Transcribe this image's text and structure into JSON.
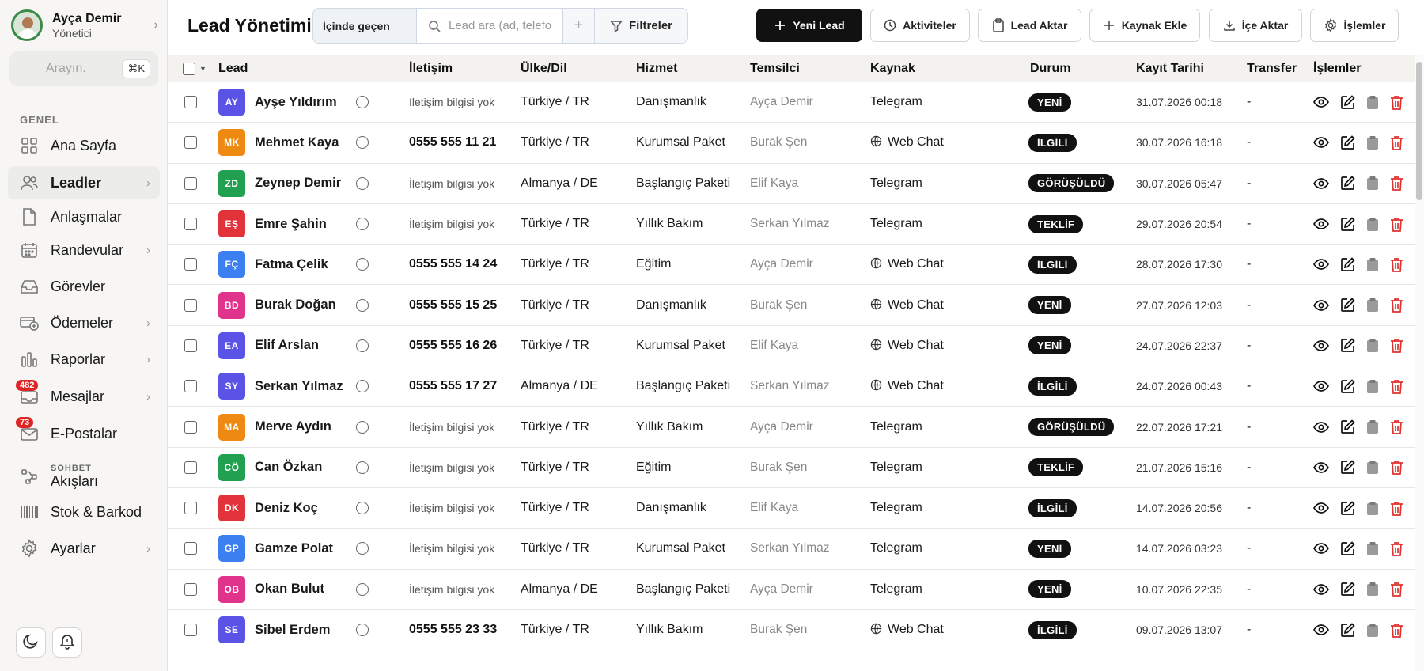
{
  "profile": {
    "name": "Ayça Demir",
    "role": "Yönetici"
  },
  "search": {
    "placeholder": "Arayın.",
    "shortcut": "⌘K"
  },
  "sidebar": {
    "section": "GENEL",
    "items": [
      {
        "label": "Ana Sayfa",
        "icon": "grid-icon"
      },
      {
        "label": "Leadler",
        "icon": "users-icon",
        "active": true
      },
      {
        "label": "Anlaşmalar",
        "icon": "document-icon"
      },
      {
        "label": "Randevular",
        "icon": "calendar-icon"
      },
      {
        "label": "Görevler",
        "icon": "inbox-icon"
      },
      {
        "label": "Ödemeler",
        "icon": "payments-icon"
      },
      {
        "label": "Raporlar",
        "icon": "bar-chart-icon"
      },
      {
        "label": "Mesajlar",
        "icon": "message-icon",
        "badge": "482"
      },
      {
        "label": "E-Postalar",
        "icon": "mail-icon",
        "badge": "73"
      },
      {
        "small": "SOHBET",
        "label": "Akışları",
        "icon": "flow-icon"
      },
      {
        "label": "Stok & Barkod",
        "icon": "barcode-icon"
      },
      {
        "label": "Ayarlar",
        "icon": "gear-icon"
      }
    ]
  },
  "header": {
    "title": "Lead Yönetimi",
    "filter_mode": "İçinde geçen",
    "search_placeholder": "Lead ara (ad, telefon, e-posta)",
    "filters_label": "Filtreler",
    "buttons": {
      "new_lead": "Yeni Lead",
      "activities": "Aktiviteler",
      "transfer": "Lead Aktar",
      "add_source": "Kaynak Ekle",
      "import": "İçe Aktar",
      "operations": "İşlemler"
    }
  },
  "table": {
    "columns": [
      "Lead",
      "İletişim",
      "Ülke/Dil",
      "Hizmet",
      "Temsilci",
      "Kaynak",
      "Durum",
      "Kayıt Tarihi",
      "Transfer",
      "İşlemler"
    ],
    "rows": [
      {
        "initials": "AY",
        "color": "#5b52e6",
        "name": "Ayşe Yıldırım",
        "contact": "İletişim bilgisi yok",
        "country": "Türkiye / TR",
        "service": "Danışmanlık",
        "rep": "Ayça Demir",
        "source": "Telegram",
        "status": "YENİ",
        "date": "31.07.2026 00:18",
        "transfer": "-"
      },
      {
        "initials": "MK",
        "color": "#ee8a12",
        "name": "Mehmet Kaya",
        "contact": "0555 555 11 21",
        "country": "Türkiye / TR",
        "service": "Kurumsal Paket",
        "rep": "Burak Şen",
        "source": "Web Chat",
        "status": "İLGİLİ",
        "date": "30.07.2026 16:18",
        "transfer": "-"
      },
      {
        "initials": "ZD",
        "color": "#22a052",
        "name": "Zeynep Demir",
        "contact": "İletişim bilgisi yok",
        "country": "Almanya / DE",
        "service": "Başlangıç Paketi",
        "rep": "Elif Kaya",
        "source": "Telegram",
        "status": "GÖRÜŞÜLDÜ",
        "date": "30.07.2026 05:47",
        "transfer": "-"
      },
      {
        "initials": "EŞ",
        "color": "#e2323a",
        "name": "Emre Şahin",
        "contact": "İletişim bilgisi yok",
        "country": "Türkiye / TR",
        "service": "Yıllık Bakım",
        "rep": "Serkan Yılmaz",
        "source": "Telegram",
        "status": "TEKLİF",
        "date": "29.07.2026 20:54",
        "transfer": "-"
      },
      {
        "initials": "FÇ",
        "color": "#3b7ff0",
        "name": "Fatma Çelik",
        "contact": "0555 555 14 24",
        "country": "Türkiye / TR",
        "service": "Eğitim",
        "rep": "Ayça Demir",
        "source": "Web Chat",
        "status": "İLGİLİ",
        "date": "28.07.2026 17:30",
        "transfer": "-"
      },
      {
        "initials": "BD",
        "color": "#e0338c",
        "name": "Burak Doğan",
        "contact": "0555 555 15 25",
        "country": "Türkiye / TR",
        "service": "Danışmanlık",
        "rep": "Burak Şen",
        "source": "Web Chat",
        "status": "YENİ",
        "date": "27.07.2026 12:03",
        "transfer": "-"
      },
      {
        "initials": "EA",
        "color": "#5b52e6",
        "name": "Elif Arslan",
        "contact": "0555 555 16 26",
        "country": "Türkiye / TR",
        "service": "Kurumsal Paket",
        "rep": "Elif Kaya",
        "source": "Web Chat",
        "status": "YENİ",
        "date": "24.07.2026 22:37",
        "transfer": "-"
      },
      {
        "initials": "SY",
        "color": "#5b52e6",
        "name": "Serkan Yılmaz",
        "contact": "0555 555 17 27",
        "country": "Almanya / DE",
        "service": "Başlangıç Paketi",
        "rep": "Serkan Yılmaz",
        "source": "Web Chat",
        "status": "İLGİLİ",
        "date": "24.07.2026 00:43",
        "transfer": "-"
      },
      {
        "initials": "MA",
        "color": "#ee8a12",
        "name": "Merve Aydın",
        "contact": "İletişim bilgisi yok",
        "country": "Türkiye / TR",
        "service": "Yıllık Bakım",
        "rep": "Ayça Demir",
        "source": "Telegram",
        "status": "GÖRÜŞÜLDÜ",
        "date": "22.07.2026 17:21",
        "transfer": "-"
      },
      {
        "initials": "CÖ",
        "color": "#22a052",
        "name": "Can Özkan",
        "contact": "İletişim bilgisi yok",
        "country": "Türkiye / TR",
        "service": "Eğitim",
        "rep": "Burak Şen",
        "source": "Telegram",
        "status": "TEKLİF",
        "date": "21.07.2026 15:16",
        "transfer": "-"
      },
      {
        "initials": "DK",
        "color": "#e2323a",
        "name": "Deniz Koç",
        "contact": "İletişim bilgisi yok",
        "country": "Türkiye / TR",
        "service": "Danışmanlık",
        "rep": "Elif Kaya",
        "source": "Telegram",
        "status": "İLGİLİ",
        "date": "14.07.2026 20:56",
        "transfer": "-"
      },
      {
        "initials": "GP",
        "color": "#3b7ff0",
        "name": "Gamze Polat",
        "contact": "İletişim bilgisi yok",
        "country": "Türkiye / TR",
        "service": "Kurumsal Paket",
        "rep": "Serkan Yılmaz",
        "source": "Telegram",
        "status": "YENİ",
        "date": "14.07.2026 03:23",
        "transfer": "-"
      },
      {
        "initials": "OB",
        "color": "#e0338c",
        "name": "Okan Bulut",
        "contact": "İletişim bilgisi yok",
        "country": "Almanya / DE",
        "service": "Başlangıç Paketi",
        "rep": "Ayça Demir",
        "source": "Telegram",
        "status": "YENİ",
        "date": "10.07.2026 22:35",
        "transfer": "-"
      },
      {
        "initials": "SE",
        "color": "#5b52e6",
        "name": "Sibel Erdem",
        "contact": "0555 555 23 33",
        "country": "Türkiye / TR",
        "service": "Yıllık Bakım",
        "rep": "Burak Şen",
        "source": "Web Chat",
        "status": "İLGİLİ",
        "date": "09.07.2026 13:07",
        "transfer": "-"
      }
    ]
  }
}
